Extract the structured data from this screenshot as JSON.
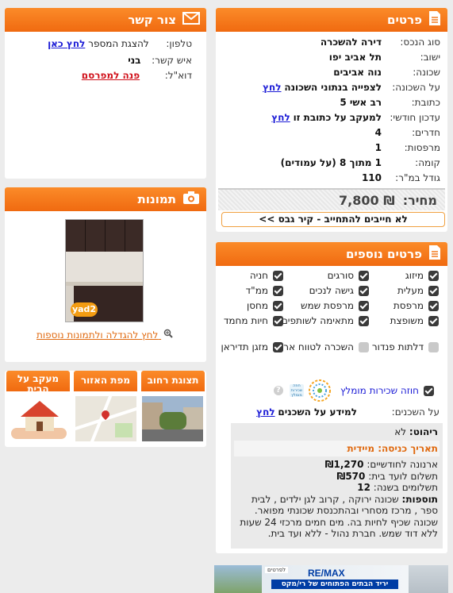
{
  "contact": {
    "title": "צור קשר",
    "phone_label": "טלפון:",
    "phone_text": "להצגת המספר",
    "phone_link": "לחץ כאן",
    "person_label": "איש קשר:",
    "person_value": "בני",
    "email_label": "דוא\"ל:",
    "email_link": "פנה למפרסם"
  },
  "photos": {
    "title": "תמונות",
    "watermark": "yad2",
    "enlarge_link": "לחץ להגדלה ולתמונות נוספות"
  },
  "tabs": [
    {
      "label": "תצוגת רחוב"
    },
    {
      "label": "מפת האזור"
    },
    {
      "label": "מעקב על הבית"
    }
  ],
  "details": {
    "title": "פרטים",
    "rows": [
      {
        "label": "סוג הנכס:",
        "value": "דירה להשכרה"
      },
      {
        "label": "ישוב:",
        "value": "תל אביב יפו"
      },
      {
        "label": "שכונה:",
        "value": "נוה אביבים"
      },
      {
        "label": "על השכונה:",
        "value": "לצפייה בנתוני השכונה",
        "link": "לחץ"
      },
      {
        "label": "כתובת:",
        "value": "רב אשי 5"
      },
      {
        "label": "עדכון חודשי:",
        "value": "למעקב על כתובת זו",
        "link": "לחץ"
      },
      {
        "label": "חדרים:",
        "value": "4"
      },
      {
        "label": "מרפסות:",
        "value": "1"
      },
      {
        "label": "קומה:",
        "value": "1 מתוך 8 (על עמודים)"
      },
      {
        "label": "גודל במ\"ר:",
        "value": "110"
      }
    ],
    "price_label": "מחיר:",
    "price_value": "₪ 7,800",
    "notice": "לא חייבים להתחייב - קיר גבס >>"
  },
  "extras": {
    "title": "פרטים נוספים",
    "features": [
      {
        "label": "מיזוג",
        "on": true
      },
      {
        "label": "סורגים",
        "on": true
      },
      {
        "label": "חניה",
        "on": true
      },
      {
        "label": "מעלית",
        "on": true
      },
      {
        "label": "גישה לנכים",
        "on": true
      },
      {
        "label": "ממ\"ד",
        "on": true
      },
      {
        "label": "מרפסת",
        "on": true
      },
      {
        "label": "מרפסת שמש",
        "on": true
      },
      {
        "label": "מחסן",
        "on": true
      },
      {
        "label": "משופצת",
        "on": true
      },
      {
        "label": "מתאימה לשותפים",
        "on": true
      },
      {
        "label": "חיות מחמד",
        "on": true
      },
      {
        "label": "דלתות פנדור",
        "on": false
      },
      {
        "label": "השכרה לטווח ארוך",
        "on": false
      },
      {
        "label": "מזגן תדיראן",
        "on": true
      }
    ],
    "contract_label": "חוזה שכירות מומלץ",
    "contract_logo": "חוזה שכירות מומלץ",
    "neighbors_label": "על השכנים:",
    "neighbors_text": "למידע על השכנים",
    "neighbors_link": "לחץ",
    "furniture_label": "ריהוט:",
    "furniture_value": "לא",
    "entry_label": "תאריך כניסה:",
    "entry_value": "מיידית",
    "arnona_label": "ארנונה לחודשיים:",
    "arnona_value": "₪1,270",
    "vaad_label": "תשלום לועד בית:",
    "vaad_value": "₪570",
    "payments_label": "תשלומים בשנה:",
    "payments_value": "12",
    "additions_label": "תוספות:",
    "additions_value": "שכונה ירוקה , קרוב לגן ילדים , לבית ספר , מרכז מסחרי ובהתכנסת שכונתי מפואר. שכונה שכיף לחיות בה. מים חמים מרכזי 24 שעות ללא דוד שמש. חברת נהול - ללא ועד בית."
  },
  "banner": {
    "brand": "RE/MAX",
    "tagline": "יריד הבתים הפתוחים של רי/מקס",
    "tag": "לפרטים"
  },
  "colors": {
    "accent": "#f47a1f",
    "link": "#1b1bd6"
  }
}
